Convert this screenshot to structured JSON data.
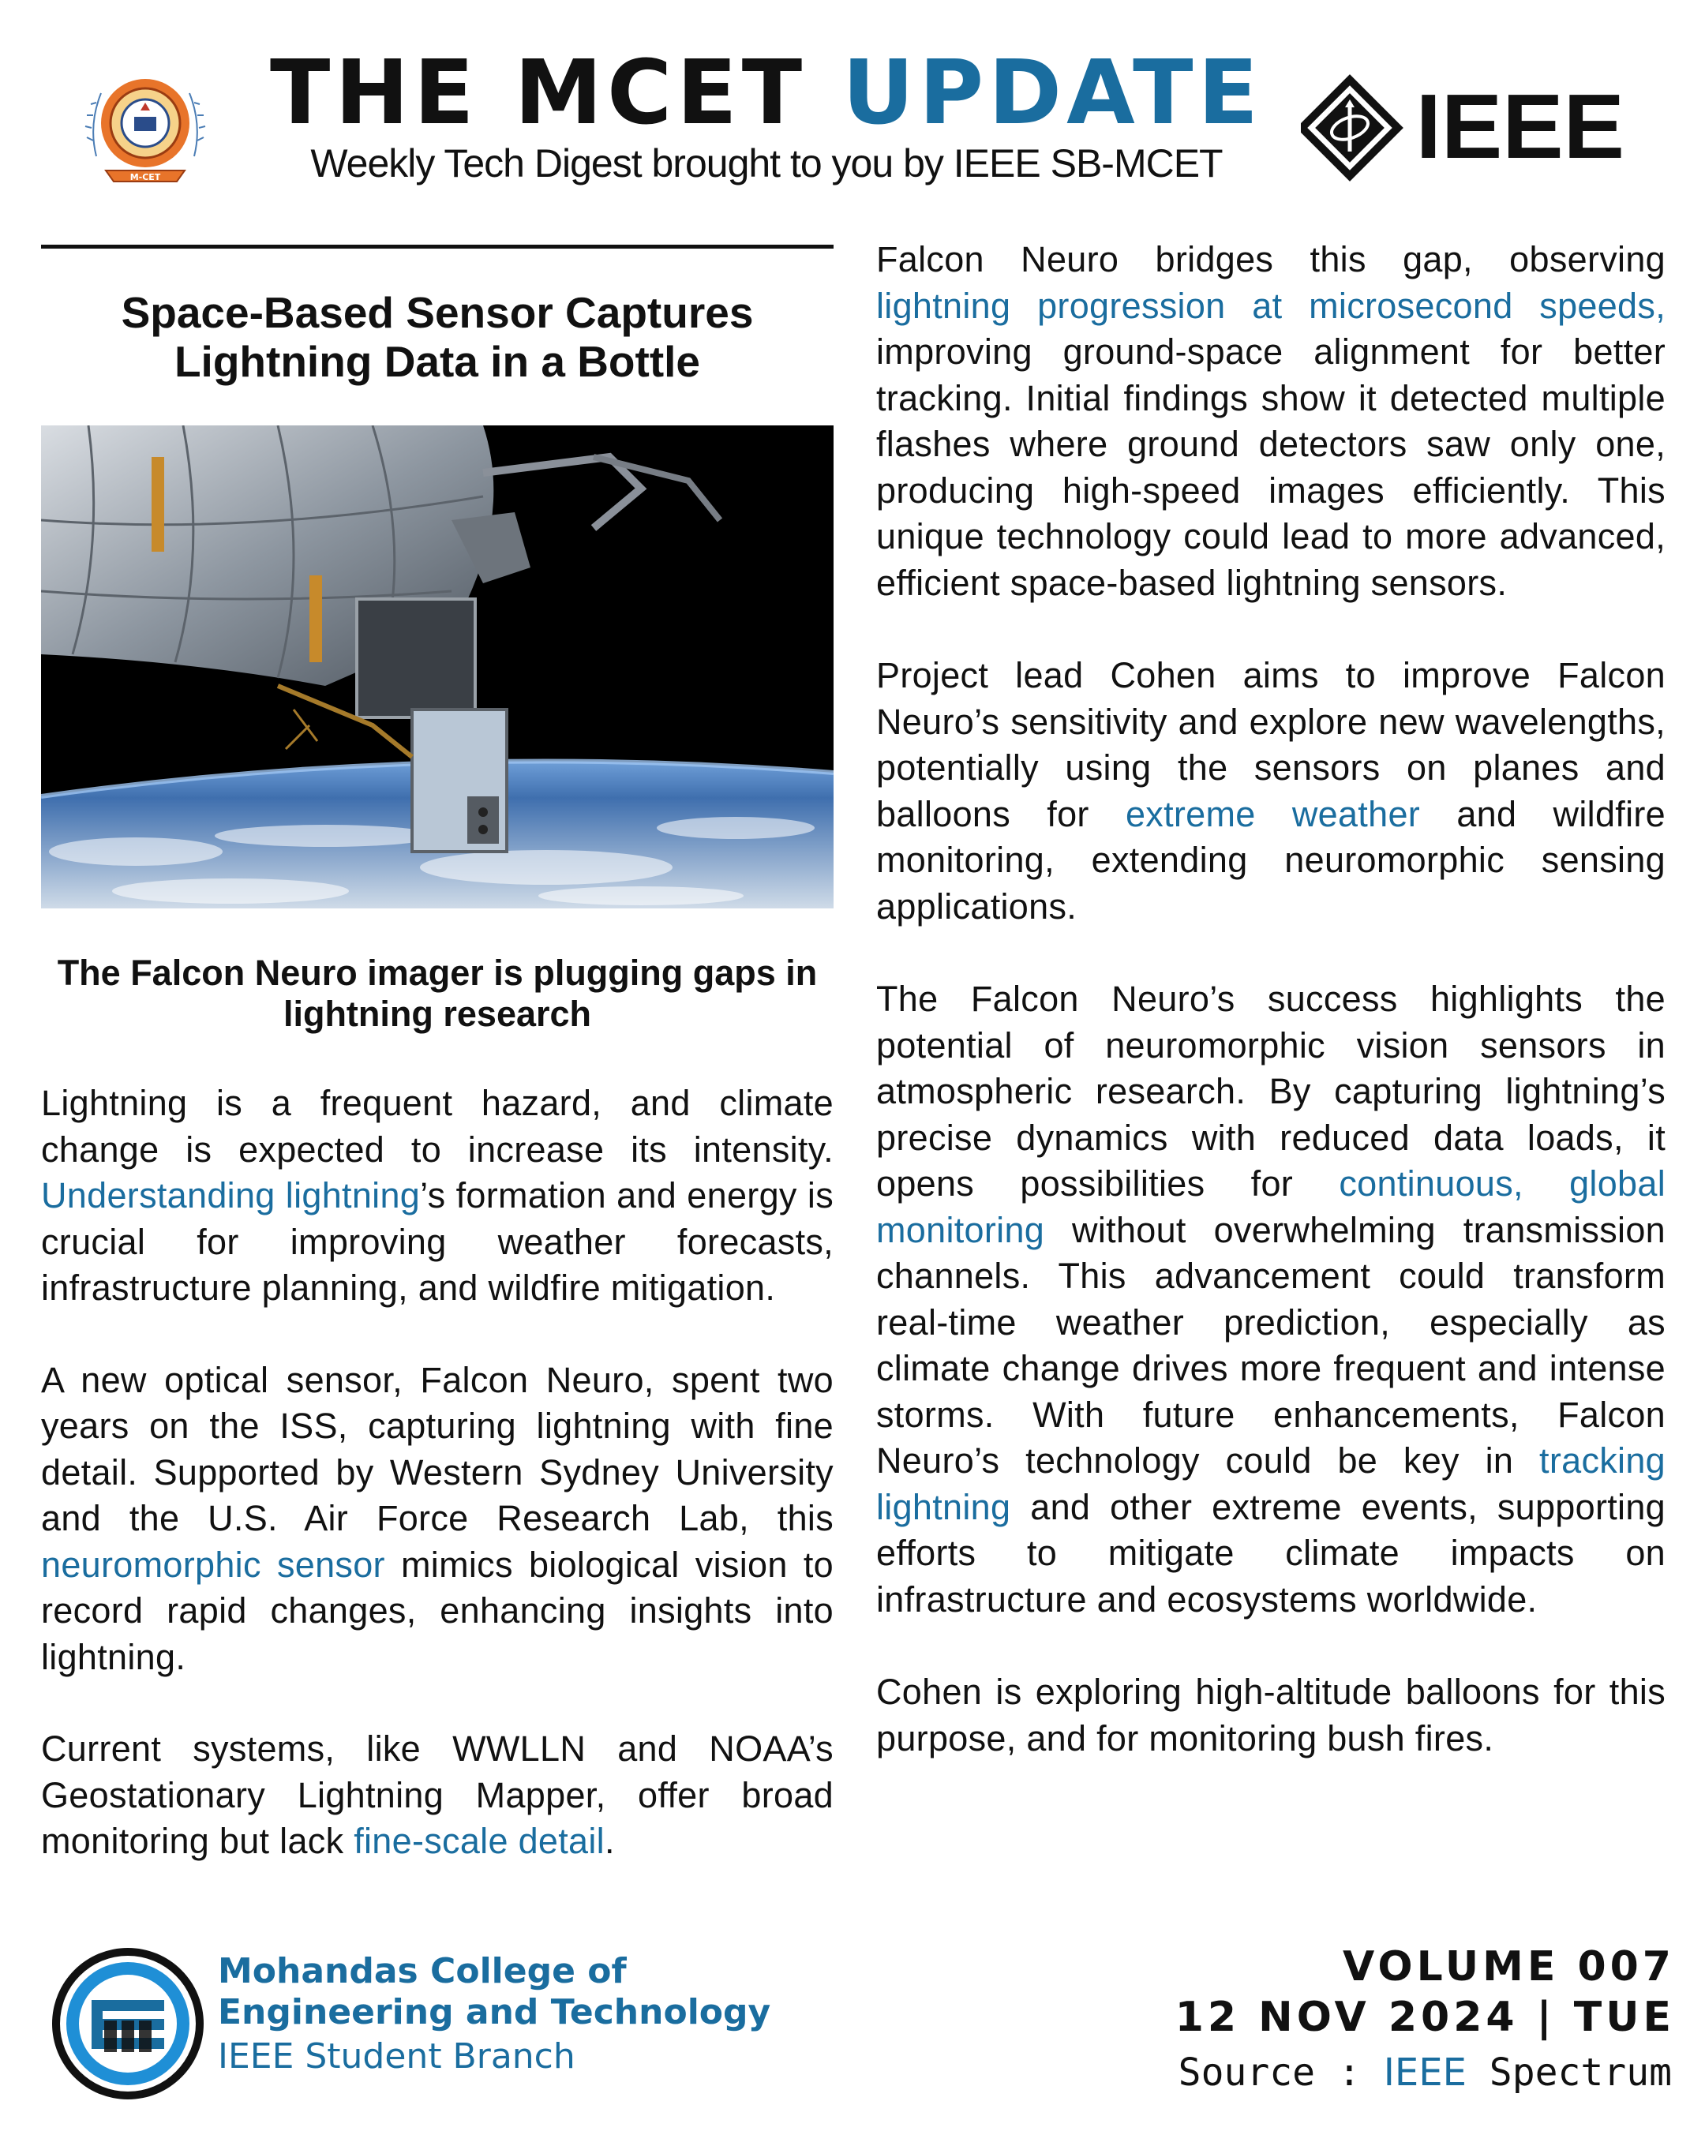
{
  "header": {
    "title_dark": "THE MCET",
    "title_blue": "UPDATE",
    "subtitle": "Weekly Tech Digest brought to you by IEEE SB-MCET",
    "mcet_logo_text": "M-CET",
    "ieee_logo_text": "IEEE"
  },
  "article": {
    "headline": "Space-Based Sensor Captures Lightning Data in a Bottle",
    "subheadline": "The Falcon Neuro imager is plugging gaps in lightning research",
    "p1": {
      "a": "Lightning is a frequent hazard, and climate change is expected to increase its intensity. ",
      "link": "Understanding lightning",
      "b": "’s formation and energy is crucial for improving weather forecasts, infrastructure planning, and wildfire mitigation."
    },
    "p2": {
      "a": "A new optical sensor, Falcon Neuro, spent two years on the ISS, capturing lightning with fine detail. Supported by Western Sydney University and the U.S. Air Force Research Lab, this ",
      "link": "neuromorphic sensor",
      "b": " mimics biological vision to record rapid changes, enhancing insights into lightning."
    },
    "p3": {
      "a": "Current systems, like WWLLN and NOAA’s Geostationary Lightning Mapper, offer broad monitoring but lack ",
      "link": "fine-scale detail",
      "b": "."
    },
    "p4": {
      "a": "Falcon Neuro bridges this gap, observing ",
      "link": "lightning progression at microsecond speeds,",
      "b": " improving ground-space alignment for better tracking. Initial findings show it detected multiple flashes where ground detectors saw only one, producing high-speed images efficiently. This unique technology could lead to more advanced, efficient space-based lightning sensors."
    },
    "p5": {
      "a": "Project lead Cohen aims to improve Falcon Neuro’s sensitivity and explore new wavelengths, potentially using the sensors on planes and balloons for ",
      "link": "extreme weather",
      "b": " and wildfire monitoring, extending neuromorphic sensing applications."
    },
    "p6": {
      "a": "The Falcon Neuro’s success highlights the potential of neuromorphic vision sensors in atmospheric research. By capturing lightning’s precise dynamics with reduced data loads, it opens possibilities for ",
      "link1": "continuous, global monitoring",
      "b": " without overwhelming transmission channels. This advancement could transform real-time weather prediction, especially as climate change drives more frequent and intense storms. With future enhancements, Falcon Neuro’s technology could be key in ",
      "link2": "tracking lightning",
      "c": " and other extreme events, supporting efforts to mitigate climate impacts on infrastructure and ecosystems worldwide."
    },
    "p7": "Cohen is exploring high-altitude balloons for this purpose, and for monitoring bush fires."
  },
  "footer": {
    "college_line1": "Mohandas College of",
    "college_line2": "Engineering and Technology",
    "branch": "IEEE Student Branch",
    "volume": "VOLUME 007",
    "date": "12 NOV 2024 | TUE",
    "source_label": "Source : ",
    "source_org": "IEEE",
    "source_pub": " Spectrum"
  },
  "colors": {
    "accent": "#1a6d9f",
    "text": "#111111",
    "logo_orange": "#e8742a"
  }
}
